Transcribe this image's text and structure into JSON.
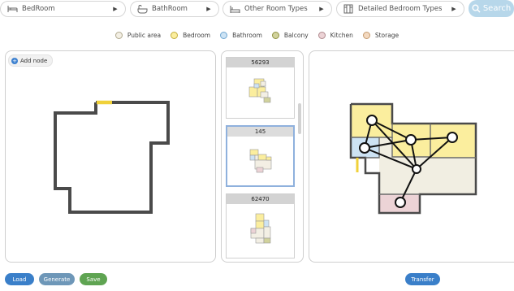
{
  "dropdowns": [
    {
      "label": "BedRoom",
      "icon": "bed-icon"
    },
    {
      "label": "BathRoom",
      "icon": "bathtub-icon"
    },
    {
      "label": "Other Room Types",
      "icon": "sofa-icon"
    },
    {
      "label": "Detailed Bedroom Types",
      "icon": "door-panel-icon"
    }
  ],
  "search_label": "Search",
  "legend": [
    {
      "label": "Public area",
      "fill": "#f3efe4",
      "stroke": "#b0a98e"
    },
    {
      "label": "Bedroom",
      "fill": "#fbee9e",
      "stroke": "#c2ad3c"
    },
    {
      "label": "Bathroom",
      "fill": "#cde3f4",
      "stroke": "#6ea6d0"
    },
    {
      "label": "Balcony",
      "fill": "#d1d29c",
      "stroke": "#8f9140"
    },
    {
      "label": "Kitchen",
      "fill": "#ecd3d6",
      "stroke": "#b08a8e"
    },
    {
      "label": "Storage",
      "fill": "#f3d9c0",
      "stroke": "#c49a6e"
    }
  ],
  "add_node_label": "Add node",
  "results": [
    {
      "id": "56293",
      "selected": false
    },
    {
      "id": "145",
      "selected": true
    },
    {
      "id": "62470",
      "selected": false
    }
  ],
  "buttons": {
    "load": "Load",
    "generate": "Generate",
    "save": "Save",
    "transfer": "Transfer"
  },
  "colors": {
    "load": "#3a7fc9",
    "generate": "#6e97b8",
    "save": "#5fa452",
    "transfer": "#3a7fc9",
    "door": "#f0d13a",
    "wall": "#4a4a4a"
  }
}
